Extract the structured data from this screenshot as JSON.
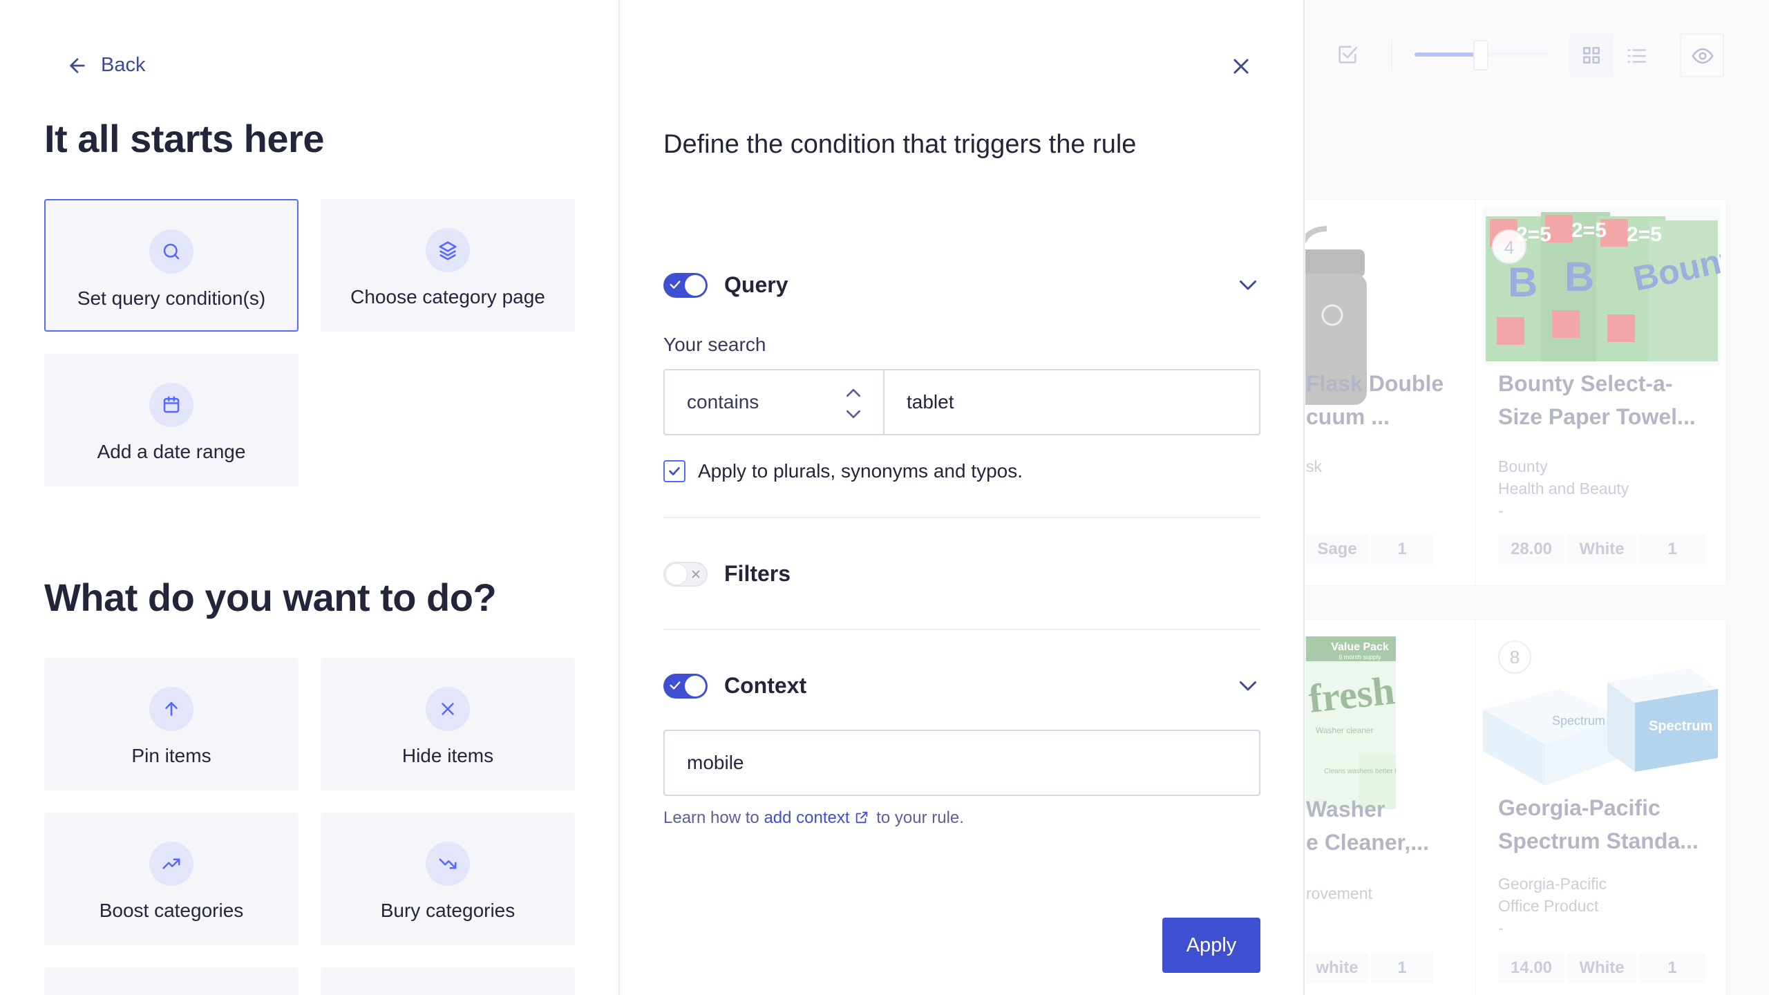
{
  "left": {
    "back_label": "Back",
    "start_title": "It all starts here",
    "start_cards": [
      {
        "label": "Set query condition(s)",
        "icon": "search-icon"
      },
      {
        "label": "Choose category page",
        "icon": "layers-icon"
      },
      {
        "label": "Add a date range",
        "icon": "calendar-icon"
      }
    ],
    "action_title": "What do you want to do?",
    "action_cards": [
      {
        "label": "Pin items",
        "icon": "arrow-up-icon"
      },
      {
        "label": "Hide items",
        "icon": "x-icon"
      },
      {
        "label": "Boost categories",
        "icon": "trending-up-icon"
      },
      {
        "label": "Bury categories",
        "icon": "trending-down-icon"
      }
    ]
  },
  "middle": {
    "title": "Define the condition that triggers the rule",
    "query": {
      "label": "Query",
      "enabled": true,
      "your_search_label": "Your search",
      "operator": "contains",
      "value": "tablet",
      "apply_variants_label": "Apply to plurals, synonyms and typos.",
      "apply_variants_checked": true
    },
    "filters": {
      "label": "Filters",
      "enabled": false
    },
    "context": {
      "label": "Context",
      "enabled": true,
      "value": "mobile",
      "help_prefix": "Learn how to",
      "help_link": "add context",
      "help_suffix": "to your rule."
    },
    "apply_label": "Apply"
  },
  "right": {
    "products": [
      {
        "title1": "Flask Double",
        "title2": "cuum ...",
        "brand1": "sk",
        "brand2": "",
        "chips": [
          "Sage",
          "1"
        ]
      },
      {
        "rank": "4",
        "title1": "Bounty Select-a-",
        "title2": "Size Paper Towel...",
        "brand1": "Bounty",
        "brand2": "Health and Beauty",
        "dash": "-",
        "chips": [
          "28.00",
          "White",
          "1"
        ]
      },
      {
        "title1": "Washer",
        "title2": "e Cleaner,...",
        "brand1": "rovement",
        "brand2": "",
        "chips": [
          "white",
          "1"
        ]
      },
      {
        "rank": "8",
        "title1": "Georgia-Pacific",
        "title2": "Spectrum Standa...",
        "brand1": "Georgia-Pacific",
        "brand2": "Office Product",
        "dash": "-",
        "chips": [
          "14.00",
          "White",
          "1"
        ]
      }
    ],
    "product_image_text": {
      "bounty_count": "2=5",
      "bounty_brand": "Bounty",
      "bounty_letter": "B",
      "fresh_pack": "Value Pack",
      "fresh_pack_sub": "6 month supply",
      "fresh_brand": "fresh",
      "fresh_sub": "Washer cleaner",
      "fresh_claim": "Cleans washers better than bleach",
      "spectrum_brand": "Spectrum"
    },
    "colors": {
      "accent": "#5468ff",
      "primary": "#3f4fd1"
    }
  }
}
